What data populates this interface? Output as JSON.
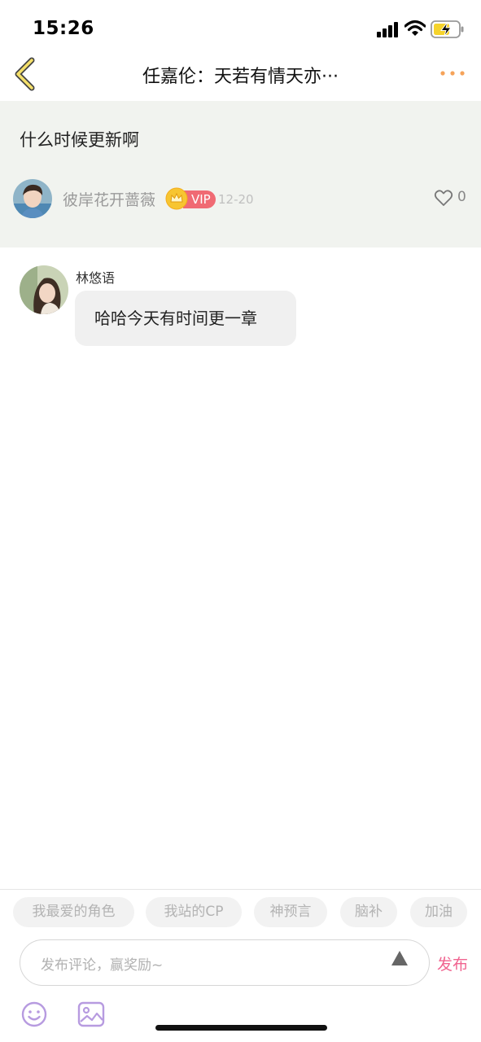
{
  "status_bar": {
    "time": "15:26"
  },
  "nav": {
    "title": "任嘉伦：天若有情天亦···",
    "back_icon": "chevron-left-icon",
    "more_icon": "more-dots-icon",
    "accent_color": "#f5a35a"
  },
  "original_post": {
    "text": "什么时候更新啊",
    "author": "彼岸花开蔷薇",
    "vip_label": "VIP",
    "date": "12-20",
    "like_count": "0",
    "background": "#f1f3ef"
  },
  "reply": {
    "author": "林悠语",
    "text": "哈哈今天有时间更一章"
  },
  "quick_tags": [
    "我最爱的角色",
    "我站的CP",
    "神预言",
    "脑补",
    "加油"
  ],
  "comment_box": {
    "placeholder": "发布评论，赢奖励~",
    "send_label": "发布",
    "send_color": "#f06490"
  },
  "toolbar_icons": [
    "emoji-icon",
    "image-icon"
  ]
}
